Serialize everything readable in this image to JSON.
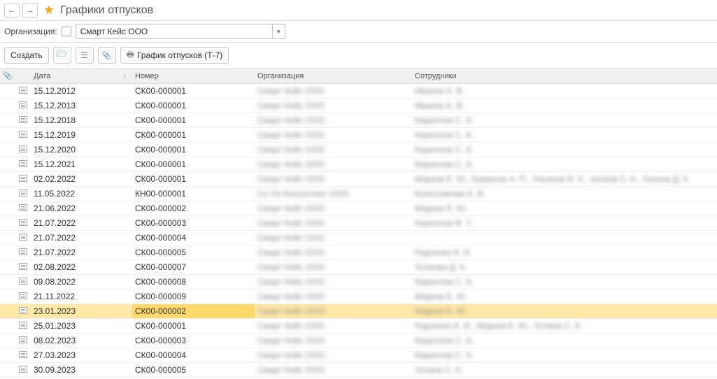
{
  "header": {
    "title": "Графики отпусков"
  },
  "filter": {
    "label": "Организация:",
    "value": "Смарт Кейс ООО"
  },
  "toolbar": {
    "create_label": "Создать",
    "print_label": "График отпусков (Т-7)"
  },
  "columns": {
    "date": "Дата",
    "number": "Номер",
    "org": "Организация",
    "emp": "Сотрудники"
  },
  "rows": [
    {
      "date": "15.12.2012",
      "number": "СК00-000001",
      "org": "Смарт Кейс ООО",
      "emp": "Иванов А. В.",
      "selected": false
    },
    {
      "date": "15.12.2013",
      "number": "СК00-000001",
      "org": "Смарт Кейс ООО",
      "emp": "Иванов А. В.",
      "selected": false
    },
    {
      "date": "15.12.2018",
      "number": "СК00-000001",
      "org": "Смарт Кейс ООО",
      "emp": "Кириллов С. А.",
      "selected": false
    },
    {
      "date": "15.12.2019",
      "number": "СК00-000001",
      "org": "Смарт Кейс ООО",
      "emp": "Кириллов С. А.",
      "selected": false
    },
    {
      "date": "15.12.2020",
      "number": "СК00-000001",
      "org": "Смарт Кейс ООО",
      "emp": "Кириллов С. А.",
      "selected": false
    },
    {
      "date": "15.12.2021",
      "number": "СК00-000001",
      "org": "Смарт Кейс ООО",
      "emp": "Кириллов С. А.",
      "selected": false
    },
    {
      "date": "02.02.2022",
      "number": "СК00-000001",
      "org": "Смарт Кейс ООО",
      "emp": "Марков Е. Ю., Ерманов А. П., Ульянов Ф. К., Холков С. К., Холков Д. К.",
      "selected": false
    },
    {
      "date": "11.05.2022",
      "number": "КН00-000001",
      "org": "Со Уа Консалтинг ООО",
      "emp": "Колесникова А. В.",
      "selected": false
    },
    {
      "date": "21.06.2022",
      "number": "СК00-000002",
      "org": "Смарт Кейс ООО",
      "emp": "Марков Е. Ю.",
      "selected": false
    },
    {
      "date": "21.07.2022",
      "number": "СК00-000003",
      "org": "Смарт Кейс ООО",
      "emp": "Кириллов Ф. Т.",
      "selected": false
    },
    {
      "date": "21.07.2022",
      "number": "СК00-000004",
      "org": "Смарт Кейс ООО",
      "emp": "",
      "selected": false
    },
    {
      "date": "21.07.2022",
      "number": "СК00-000005",
      "org": "Смарт Кейс ООО",
      "emp": "Радченко К. И.",
      "selected": false
    },
    {
      "date": "02.08.2022",
      "number": "СК00-000007",
      "org": "Смарт Кейс ООО",
      "emp": "Холкова Д. К.",
      "selected": false
    },
    {
      "date": "09.08.2022",
      "number": "СК00-000008",
      "org": "Смарт Кейс ООО",
      "emp": "Кириллов С. А.",
      "selected": false
    },
    {
      "date": "21.11.2022",
      "number": "СК00-000009",
      "org": "Смарт Кейс ООО",
      "emp": "Марков Е. Ю.",
      "selected": false
    },
    {
      "date": "23.01.2023",
      "number": "СК00-000002",
      "org": "Смарт Кейс ООО",
      "emp": "Марков Е. Ю.",
      "selected": true
    },
    {
      "date": "25.01.2023",
      "number": "СК00-000001",
      "org": "Смарт Кейс ООО",
      "emp": "Радченко К. И., Марков Е. Ю., Холков С. К.",
      "selected": false
    },
    {
      "date": "08.02.2023",
      "number": "СК00-000003",
      "org": "Смарт Кейс ООО",
      "emp": "Кириллов С. А.",
      "selected": false
    },
    {
      "date": "27.03.2023",
      "number": "СК00-000004",
      "org": "Смарт Кейс ООО",
      "emp": "Кириллов С. А.",
      "selected": false
    },
    {
      "date": "30.09.2023",
      "number": "СК00-000005",
      "org": "Смарт Кейс ООО",
      "emp": "Холков С. К.",
      "selected": false
    }
  ]
}
